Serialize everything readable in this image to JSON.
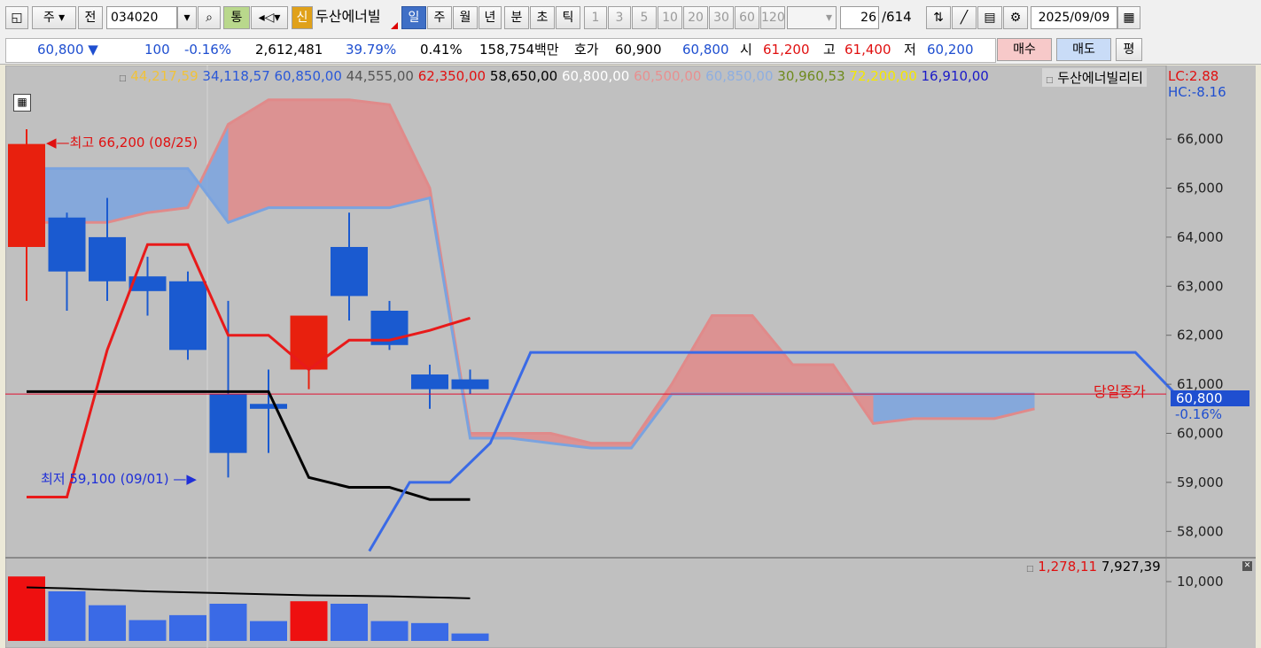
{
  "toolbar": {
    "market": "주",
    "prev": "전",
    "code": "034020",
    "unified": "통",
    "new_badge": "신",
    "stock_name": "두산에너빌",
    "periods": [
      {
        "label": "일",
        "active": true
      },
      {
        "label": "주",
        "active": false
      },
      {
        "label": "월",
        "active": false
      },
      {
        "label": "년",
        "active": false
      },
      {
        "label": "분",
        "active": false
      },
      {
        "label": "초",
        "active": false
      },
      {
        "label": "틱",
        "active": false
      }
    ],
    "intervals": [
      "1",
      "3",
      "5",
      "10",
      "20",
      "30",
      "60",
      "120"
    ],
    "count": "26",
    "total": "/614",
    "date": "2025/09/09"
  },
  "quote": {
    "price": "60,800",
    "change": "100",
    "change_pct": "-0.16%",
    "volume": "2,612,481",
    "ratio": "39.79%",
    "turnover": "0.41%",
    "amount": "158,754백만",
    "ask_label": "호가",
    "ask1": "60,900",
    "ask2": "60,800",
    "open_label": "시",
    "open": "61,200",
    "high_label": "고",
    "high": "61,400",
    "low_label": "저",
    "low": "60,200",
    "buy": "매수",
    "sell": "매도",
    "flat": "평"
  },
  "overlay": {
    "values": [
      {
        "text": "44,217,59",
        "color": "#f0c23a"
      },
      {
        "text": "34,118,57",
        "color": "#2a58d8"
      },
      {
        "text": "60,850,00",
        "color": "#2a58d8"
      },
      {
        "text": "44,555,00",
        "color": "#555555"
      },
      {
        "text": "62,350,00",
        "color": "#e01010"
      },
      {
        "text": "58,650,00",
        "color": "#000000"
      },
      {
        "text": "60,800,00",
        "color": "#ffffff"
      },
      {
        "text": "60,500,00",
        "color": "#e89090"
      },
      {
        "text": "60,850,00",
        "color": "#8eaee0"
      },
      {
        "text": "30,960,53",
        "color": "#6e8a1c"
      },
      {
        "text": "72,200,00",
        "color": "#f5e800"
      },
      {
        "text": "16,910,00",
        "color": "#1a1ac8"
      }
    ],
    "stock_label": "두산에너빌리티",
    "lc": "LC:2.88",
    "hc": "HC:-8.16",
    "high_note": "최고 66,200 (08/25)",
    "low_note": "최저 59,100 (09/01)",
    "close_label": "당일종가",
    "price_tag": "60,800",
    "pct_tag": "-0.16%",
    "vol_values": [
      {
        "text": "1,278,11",
        "color": "#e01010"
      },
      {
        "text": "7,927,39",
        "color": "#000000"
      }
    ],
    "vol_axis": "10,000"
  },
  "chart_data": {
    "type": "candlestick",
    "y_ticks": [
      58000,
      59000,
      60000,
      61000,
      62000,
      63000,
      64000,
      65000,
      66000
    ],
    "y_tick_labels": [
      "58,000",
      "59,000",
      "60,000",
      "61,000",
      "62,000",
      "63,000",
      "64,000",
      "65,000",
      "66,000"
    ],
    "ylim": [
      57500,
      67500
    ],
    "candles": [
      {
        "o": 63800,
        "h": 66200,
        "l": 62700,
        "c": 65900
      },
      {
        "o": 64400,
        "h": 64500,
        "l": 62500,
        "c": 63300
      },
      {
        "o": 64000,
        "h": 64800,
        "l": 62700,
        "c": 63100
      },
      {
        "o": 63200,
        "h": 63600,
        "l": 62400,
        "c": 62900
      },
      {
        "o": 63100,
        "h": 63300,
        "l": 61500,
        "c": 61700
      },
      {
        "o": 60800,
        "h": 62700,
        "l": 59100,
        "c": 59600
      },
      {
        "o": 60600,
        "h": 61300,
        "l": 59600,
        "c": 60500
      },
      {
        "o": 61300,
        "h": 62100,
        "l": 60900,
        "c": 62400
      },
      {
        "o": 63800,
        "h": 64500,
        "l": 62300,
        "c": 62800
      },
      {
        "o": 62500,
        "h": 62700,
        "l": 61700,
        "c": 61800
      },
      {
        "o": 61200,
        "h": 61400,
        "l": 60500,
        "c": 60900
      },
      {
        "o": 61100,
        "h": 61300,
        "l": 60800,
        "c": 60900
      }
    ],
    "red_line": [
      58700,
      58700,
      61700,
      63850,
      63850,
      62000,
      62000,
      61300,
      61900,
      61900,
      62100,
      62350
    ],
    "black_line": [
      60850,
      60850,
      60850,
      60850,
      60850,
      60850,
      60850,
      59100,
      58900,
      58900,
      58650,
      58650
    ],
    "blue_line": {
      "start_index": 8.5,
      "values": [
        57600,
        59000,
        59000,
        59800,
        61650,
        61650,
        61650,
        61650,
        61650,
        61650,
        61650,
        61650,
        61650,
        61650,
        61650,
        61650,
        61650,
        61650,
        61650,
        61650,
        60800
      ]
    },
    "cloud": {
      "span_a": [
        64300,
        64300,
        64300,
        64500,
        64600,
        66300,
        66800,
        66800,
        66800,
        66700,
        65000,
        60000,
        60000,
        60000,
        59800,
        59800,
        61000,
        62400,
        62400,
        61400,
        61400,
        60200,
        60300,
        60300,
        60300,
        60500
      ],
      "span_b": [
        65400,
        65400,
        65400,
        65400,
        65400,
        64300,
        64600,
        64600,
        64600,
        64600,
        64800,
        59900,
        59900,
        59800,
        59700,
        59700,
        60800,
        60800,
        60800,
        60800,
        60800,
        60800,
        60800,
        60800,
        60800,
        60800
      ]
    },
    "current_price": 60800,
    "volumes": [
      {
        "v": 1.3,
        "up": true
      },
      {
        "v": 1.0,
        "up": false
      },
      {
        "v": 0.72,
        "up": false
      },
      {
        "v": 0.42,
        "up": false
      },
      {
        "v": 0.52,
        "up": false
      },
      {
        "v": 0.75,
        "up": false
      },
      {
        "v": 0.4,
        "up": false
      },
      {
        "v": 0.8,
        "up": true
      },
      {
        "v": 0.75,
        "up": false
      },
      {
        "v": 0.4,
        "up": false
      },
      {
        "v": 0.36,
        "up": false
      },
      {
        "v": 0.15,
        "up": false
      }
    ],
    "volume_ma": [
      1.08,
      1.06,
      1.03,
      1.0,
      0.98,
      0.96,
      0.94,
      0.92,
      0.91,
      0.9,
      0.88,
      0.86
    ]
  }
}
